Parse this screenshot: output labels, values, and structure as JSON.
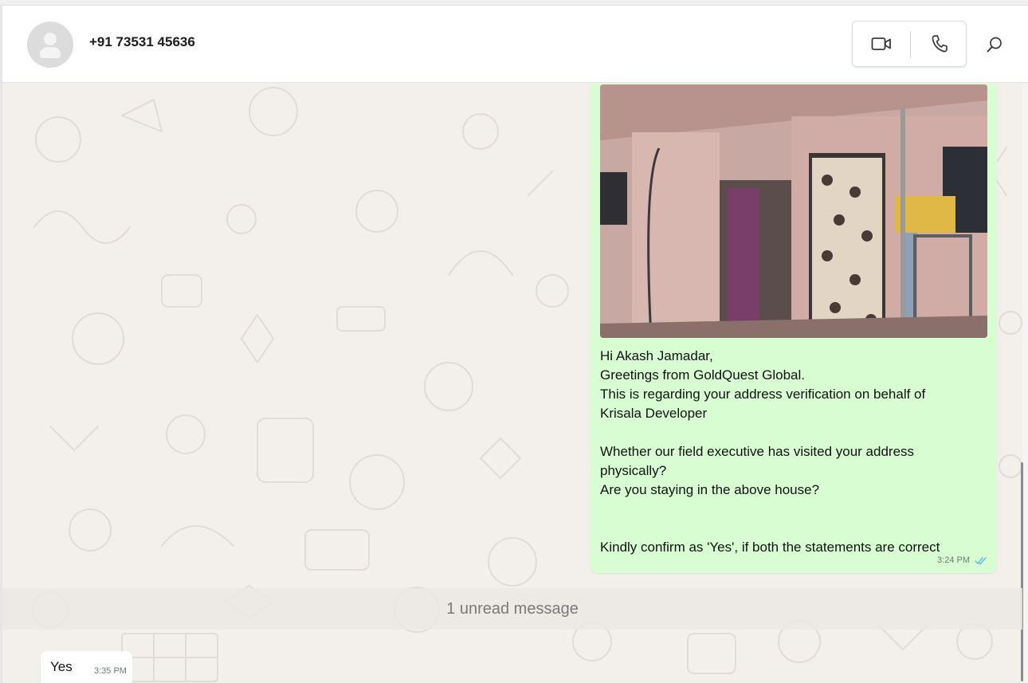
{
  "header": {
    "contact_name": "+91 73531 45636",
    "video_call_icon": "video-camera-icon",
    "voice_call_icon": "phone-icon",
    "search_icon": "search-icon"
  },
  "messages": {
    "outgoing": {
      "image": "photo-of-house-entrance",
      "text": "Hi Akash Jamadar,\nGreetings from GoldQuest Global.\nThis is regarding your address verification on behalf of\nKrisala Developer\n\nWhether our field executive has visited your address\nphysically?\nAre you staying in the above house?\n\n\nKindly confirm as 'Yes', if both the statements are correct",
      "time": "3:24 PM",
      "status": "read",
      "status_icon": "double-check-icon"
    },
    "unread_separator": "1 unread message",
    "incoming": {
      "text": "Yes",
      "time": "3:35 PM"
    }
  },
  "colors": {
    "outgoing_bubble": "#d9fdd3",
    "incoming_bubble": "#ffffff",
    "read_tick": "#53bdeb",
    "chat_background": "#f3efea"
  }
}
